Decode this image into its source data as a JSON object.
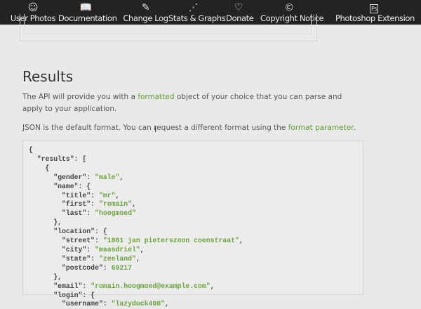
{
  "nav": [
    {
      "label": "User Photos",
      "icon": "user-photos-icon",
      "glyph": "☺"
    },
    {
      "label": "Documentation",
      "icon": "book-icon",
      "glyph": "📖"
    },
    {
      "label": "Change Log",
      "icon": "pencil-icon",
      "glyph": "✎"
    },
    {
      "label": "Stats & Graphs",
      "icon": "graph-icon",
      "glyph": "⋰"
    },
    {
      "label": "Donate",
      "icon": "heart-icon",
      "glyph": "♡"
    },
    {
      "label": "Copyright Notice",
      "icon": "copyright-icon",
      "glyph": "©"
    },
    {
      "label": "Photoshop Extension",
      "icon": "photoshop-icon",
      "glyph": "Ps"
    }
  ],
  "section": {
    "title": "Results",
    "p1_before": "The API will provide you with a ",
    "p1_link": "formatted",
    "p1_after": " object of your choice that you can parse and apply to your application.",
    "p2_before": "JSON is the default format. You can request a different format using the ",
    "p2_link": "format parameter",
    "p2_after": "."
  },
  "code_lines": [
    [
      [
        "{",
        ""
      ]
    ],
    [
      [
        "  \"results\": [",
        ""
      ]
    ],
    [
      [
        "    {",
        ""
      ]
    ],
    [
      [
        "      \"gender\": ",
        ""
      ],
      [
        "\"male\"",
        "s"
      ],
      [
        ",",
        ""
      ]
    ],
    [
      [
        "      \"name\": {",
        ""
      ]
    ],
    [
      [
        "        \"title\": ",
        ""
      ],
      [
        "\"mr\"",
        "s"
      ],
      [
        ",",
        ""
      ]
    ],
    [
      [
        "        \"first\": ",
        ""
      ],
      [
        "\"romain\"",
        "s"
      ],
      [
        ",",
        ""
      ]
    ],
    [
      [
        "        \"last\": ",
        ""
      ],
      [
        "\"hoogmoed\"",
        "s"
      ]
    ],
    [
      [
        "      },",
        ""
      ]
    ],
    [
      [
        "      \"location\": {",
        ""
      ]
    ],
    [
      [
        "        \"street\": ",
        ""
      ],
      [
        "\"1861 jan pieterszoon coenstraat\"",
        "s"
      ],
      [
        ",",
        ""
      ]
    ],
    [
      [
        "        \"city\": ",
        ""
      ],
      [
        "\"maasdriel\"",
        "s"
      ],
      [
        ",",
        ""
      ]
    ],
    [
      [
        "        \"state\": ",
        ""
      ],
      [
        "\"zeeland\"",
        "s"
      ],
      [
        ",",
        ""
      ]
    ],
    [
      [
        "        \"postcode\": ",
        ""
      ],
      [
        "69217",
        "n"
      ]
    ],
    [
      [
        "      },",
        ""
      ]
    ],
    [
      [
        "      \"email\": ",
        ""
      ],
      [
        "\"romain.hoogmoed@example.com\"",
        "s"
      ],
      [
        ",",
        ""
      ]
    ],
    [
      [
        "      \"login\": {",
        ""
      ]
    ],
    [
      [
        "        \"username\": ",
        ""
      ],
      [
        "\"lazyduck408\"",
        "s"
      ],
      [
        ",",
        ""
      ]
    ]
  ]
}
